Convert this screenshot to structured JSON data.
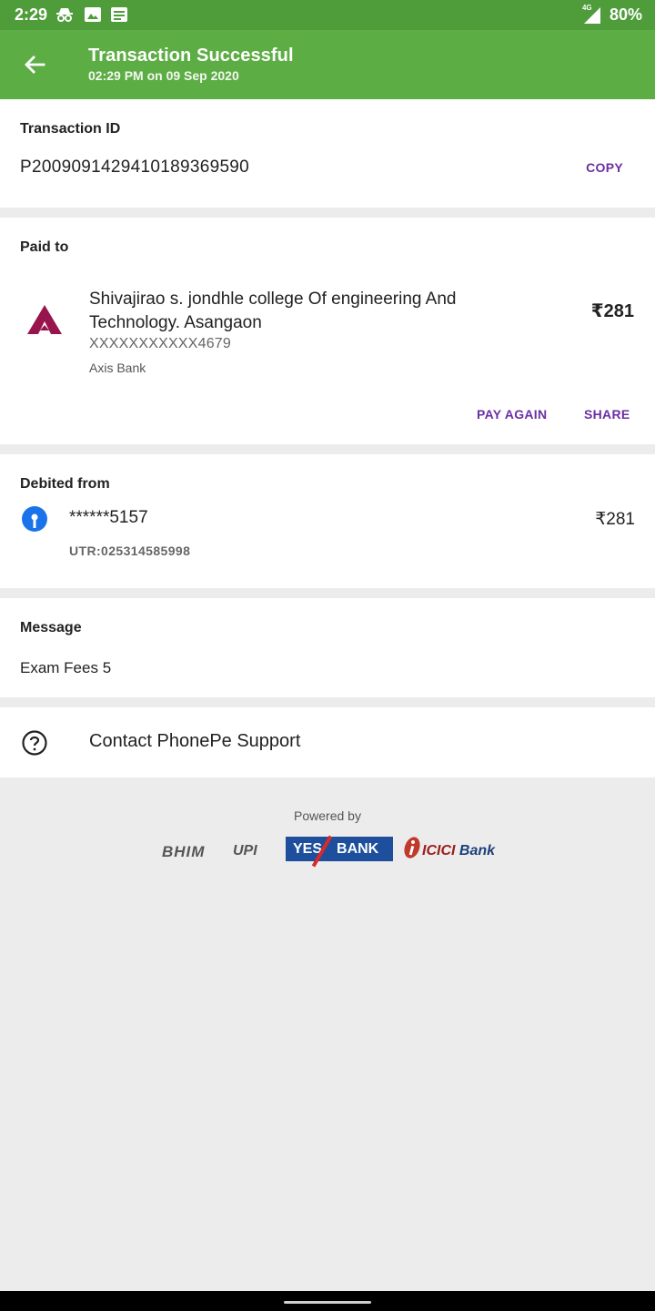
{
  "status_bar": {
    "time": "2:29",
    "network": "4G",
    "battery": "80%",
    "icons": [
      "incognito-icon",
      "image-icon",
      "notes-icon",
      "signal-icon"
    ]
  },
  "app_bar": {
    "title": "Transaction Successful",
    "subtitle": "02:29 PM on 09 Sep 2020",
    "back_icon": "arrow-left-icon"
  },
  "transaction": {
    "label": "Transaction ID",
    "id": "P2009091429410189369590",
    "copy_label": "COPY"
  },
  "paid_to": {
    "label": "Paid to",
    "name": "Shivajirao s. jondhle college Of engineering And Technology. Asangaon",
    "account": "XXXXXXXXXXX4679",
    "bank": "Axis Bank",
    "amount": "₹281",
    "pay_again_label": "PAY AGAIN",
    "share_label": "SHARE"
  },
  "debited_from": {
    "label": "Debited from",
    "account": "******5157",
    "utr": "UTR:025314585998",
    "amount": "₹281"
  },
  "message": {
    "label": "Message",
    "text": "Exam Fees 5"
  },
  "support": {
    "label": "Contact PhonePe Support"
  },
  "footer": {
    "powered_by": "Powered by",
    "logos": {
      "bhim": "BHIM",
      "upi": "UPI",
      "yes": "YES",
      "bank": "BANK",
      "icici": "ICICI",
      "icici_bank": "Bank"
    }
  },
  "colors": {
    "status_bar": "#4f9c3a",
    "app_bar": "#5dad45",
    "accent_purple": "#6b2fa3",
    "background": "#ececec"
  }
}
